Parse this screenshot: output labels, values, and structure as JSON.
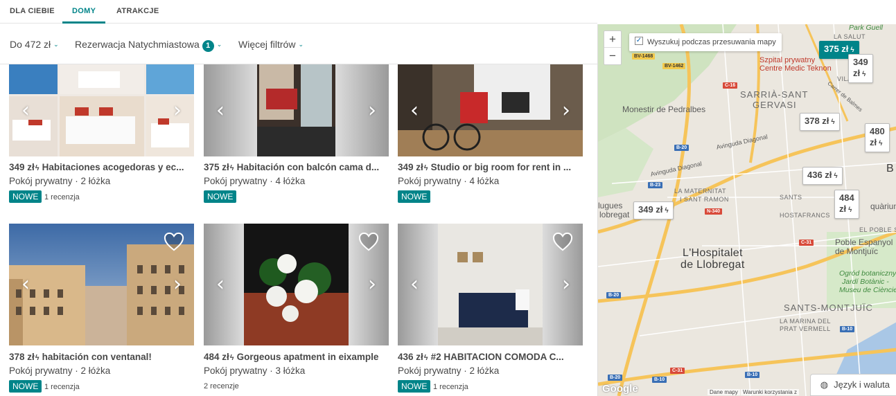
{
  "tabs": [
    {
      "label": "DLA CIEBIE",
      "active": false
    },
    {
      "label": "DOMY",
      "active": true
    },
    {
      "label": "ATRAKCJE",
      "active": false
    }
  ],
  "filters": {
    "price": "Do 472 zł",
    "instant": "Rezerwacja Natychmiastowa",
    "instant_count": "1",
    "more": "Więcej filtrów"
  },
  "listings": [
    {
      "price": "349 zł",
      "title": "Habitaciones acogedoras y ec...",
      "sub": "Pokój prywatny · 2 łóżka",
      "badge": "NOWE",
      "reviews": "1 recenzja"
    },
    {
      "price": "375 zł",
      "title": "Habitación con balcón cama d...",
      "sub": "Pokój prywatny · 4 łóżka",
      "badge": "NOWE",
      "reviews": ""
    },
    {
      "price": "349 zł",
      "title": "Studio or big room for rent in ...",
      "sub": "Pokój prywatny · 4 łóżka",
      "badge": "NOWE",
      "reviews": ""
    },
    {
      "price": "378 zł",
      "title": "habitación con ventanal!",
      "sub": "Pokój prywatny · 2 łóżka",
      "badge": "NOWE",
      "reviews": "1 recenzja"
    },
    {
      "price": "484 zł",
      "title": "Gorgeous apatment in eixample",
      "sub": "Pokój prywatny · 3 łóżka",
      "badge": "",
      "reviews": "2 recenzje"
    },
    {
      "price": "436 zł",
      "title": "#2 HABITACION COMODA C...",
      "sub": "Pokój prywatny · 2 łóżka",
      "badge": "NOWE",
      "reviews": "1 recenzja"
    }
  ],
  "map": {
    "search_when_moving": "Wyszukuj podczas przesuwania mapy",
    "search_when_moving_checked": true,
    "zoom_in": "+",
    "zoom_out": "−",
    "pins": [
      {
        "price": "375 zł",
        "selected": true
      },
      {
        "price": "349",
        "line2": "zł",
        "selected": false
      },
      {
        "price": "378 zł",
        "selected": false
      },
      {
        "price": "480",
        "line2": "zł",
        "selected": false
      },
      {
        "price": "436 zł",
        "selected": false
      },
      {
        "price": "484",
        "line2": "zł",
        "selected": false
      },
      {
        "price": "349 zł",
        "selected": false
      }
    ],
    "labels": {
      "park_guell": "Park Guell",
      "la_salut": "LA SALUT",
      "vila": "VILA",
      "hospital": "Szpital prywatny",
      "hospital2": "Centre Medic Teknon",
      "sarria": "SARRIÀ-SANT",
      "sarria2": "GERVASI",
      "pedralbes": "Monestir de Pedralbes",
      "diagonal": "Avinguda Diagonal",
      "diagonal2": "Avinguda Diagonal",
      "maternitat": "LA MATERNITAT",
      "maternitat2": "I SANT RAMON",
      "sants": "SANTS",
      "hostafrancs": "HOSTAFRANCS",
      "poble_sec": "EL POBLE S",
      "poble_espanyol": "Poble Espanyol",
      "poble_espanyol2": "de Montjuïc",
      "hospitalet": "L'Hospitalet",
      "hospitalet2": "de Llobregat",
      "esplugues": "lugues",
      "esplugues2": "lobregat",
      "ogrod": "Ogród botaniczny",
      "ogrod2": "Jardí Botànic -",
      "ogrod3": "Museu de Ciències",
      "sants_montjuic": "SANTS-MONTJUÏC",
      "marina": "LA MARINA DEL",
      "marina2": "PRAT VERMELL",
      "aquarium": "quàrium",
      "balmes": "Carrer de Balmes",
      "b_letter": "B"
    },
    "roads": [
      "BV-1468",
      "BV-1462",
      "C-16",
      "B-20",
      "B-23",
      "N-340",
      "C-31",
      "B-20",
      "B-20",
      "B-10",
      "B-10",
      "C-31",
      "B-10"
    ],
    "footer_data": "Dane mapy",
    "footer_report": "Warunki korzystania z",
    "google": "Google"
  },
  "language_button": "Język i waluta",
  "colors": {
    "accent": "#008489",
    "text": "#484848"
  }
}
